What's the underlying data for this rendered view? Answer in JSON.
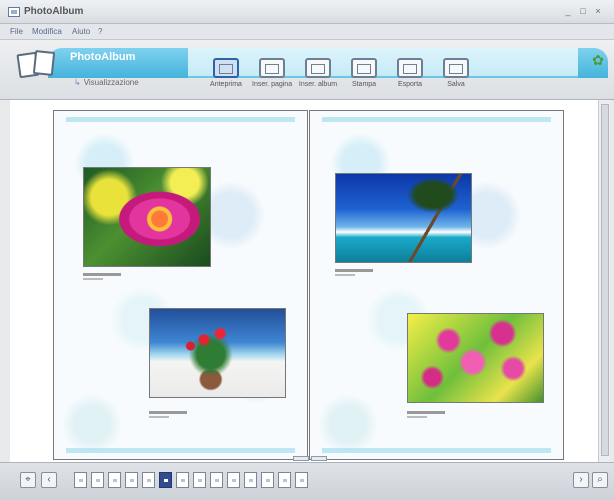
{
  "window": {
    "title": "PhotoAlbum",
    "minimize_label": "_",
    "maximize_label": "□",
    "close_label": "×"
  },
  "menu": {
    "items": [
      {
        "label": "File"
      },
      {
        "label": "Modifica"
      },
      {
        "label": "Aiuto"
      },
      {
        "label": "?"
      }
    ]
  },
  "banner": {
    "app_name": "PhotoAlbum",
    "view_link": "Visualizzazione"
  },
  "toolbar": {
    "buttons": [
      {
        "label": "Anteprima",
        "icon": "preview-icon",
        "active": true
      },
      {
        "label": "Inser. pagina",
        "icon": "insert-page-icon",
        "active": false
      },
      {
        "label": "Inser. album",
        "icon": "insert-album-icon",
        "active": false
      },
      {
        "label": "Stampa",
        "icon": "print-icon",
        "active": false
      },
      {
        "label": "Esporta",
        "icon": "export-icon",
        "active": false
      },
      {
        "label": "Salva",
        "icon": "save-icon",
        "active": false
      }
    ]
  },
  "album": {
    "left_page": {
      "photos": [
        {
          "subject": "flower-pink-water-lily"
        },
        {
          "subject": "potted-red-flower-plant-beach"
        }
      ]
    },
    "right_page": {
      "photos": [
        {
          "subject": "palm-tree-tropical-beach"
        },
        {
          "subject": "pink-flowers-yellow-green"
        }
      ]
    }
  },
  "pagination": {
    "active_tab": 7,
    "tab_count": 15
  },
  "colors": {
    "banner_accent": "#44b4dc",
    "active_page": "#334b8e"
  }
}
